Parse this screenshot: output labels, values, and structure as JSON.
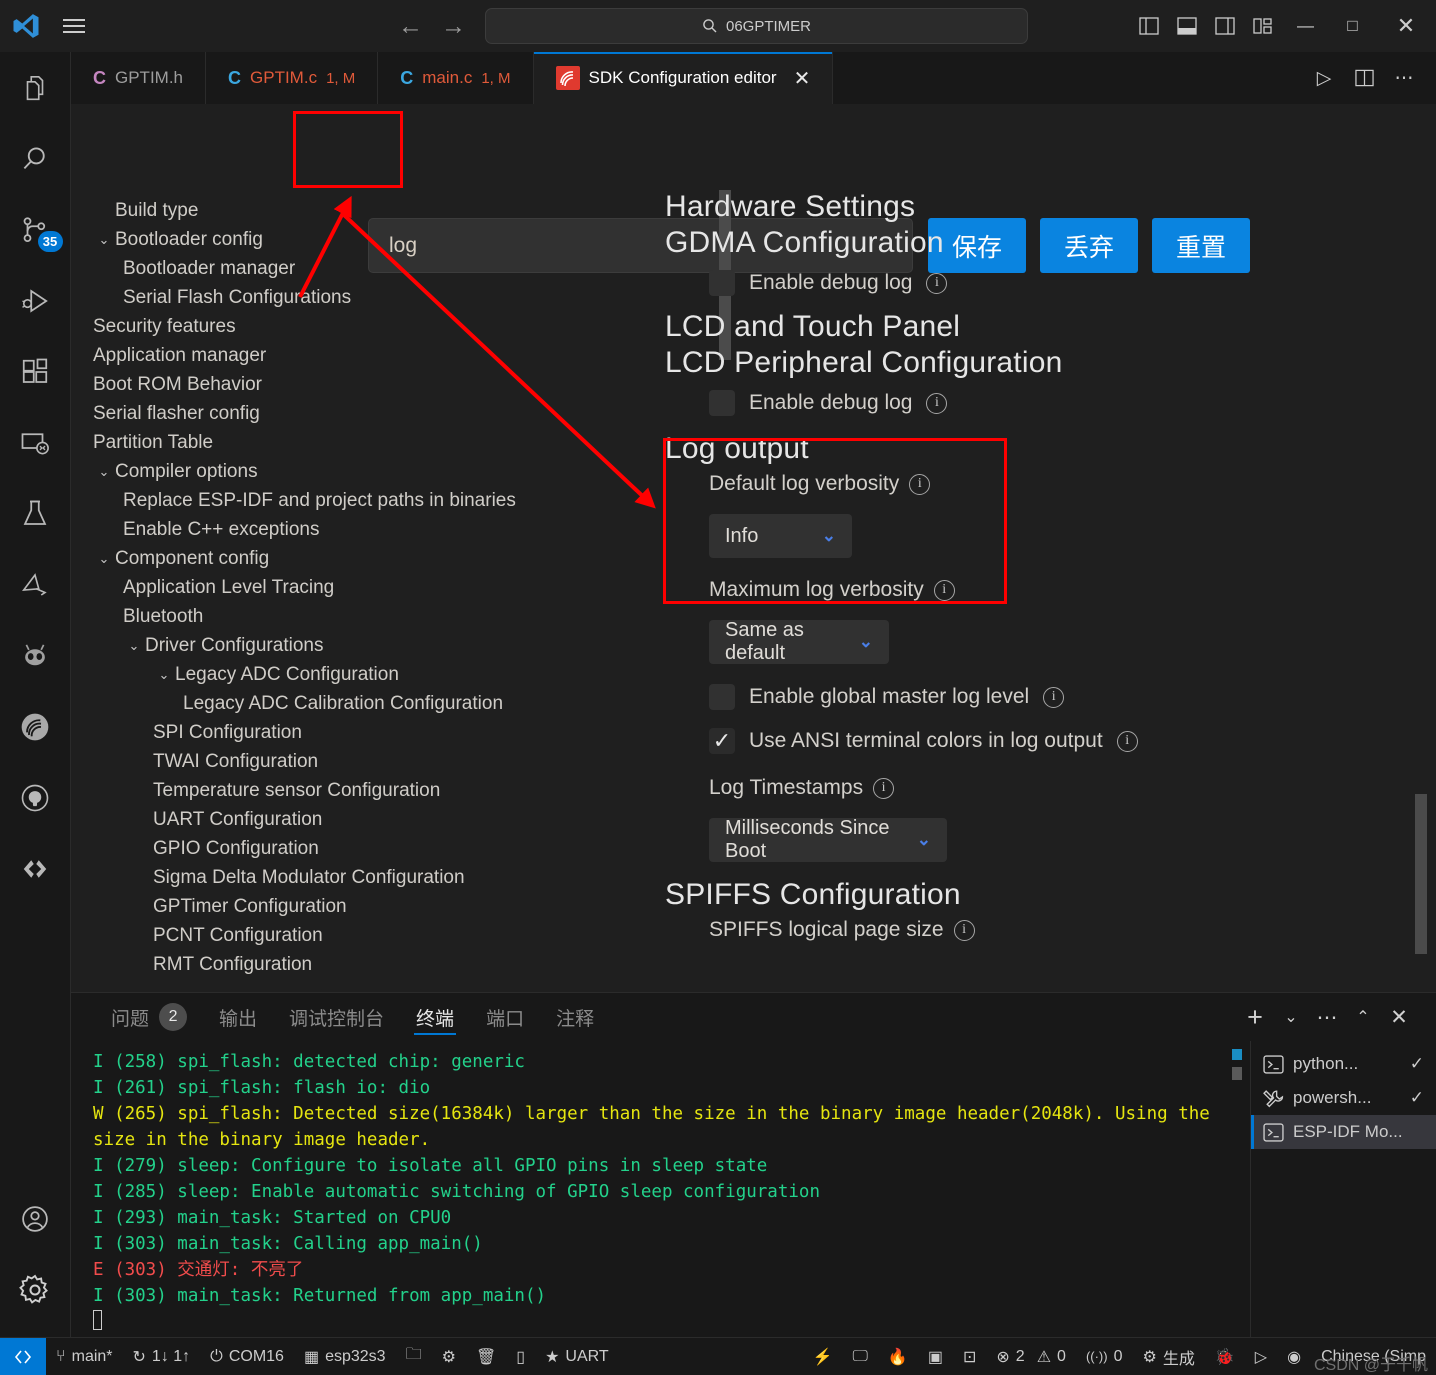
{
  "titlebar": {
    "quick_open_text": "06GPTIMER",
    "search_icon": "search-icon",
    "back_arrow": "←",
    "forward_arrow": "→",
    "minimize": "—",
    "maximize": "□",
    "close": "✕"
  },
  "editor_tabs": [
    {
      "lang": "C",
      "name": "GPTIM.h",
      "modifier": "",
      "active": false,
      "lang_color": "#c586c0",
      "name_color": "#9d9d9d"
    },
    {
      "lang": "C",
      "name": "GPTIM.c",
      "modifier": "1, M",
      "active": false,
      "lang_color": "#3ba7e0",
      "name_color": "#e05a3a"
    },
    {
      "lang": "C",
      "name": "main.c",
      "modifier": "1, M",
      "active": false,
      "lang_color": "#3ba7e0",
      "name_color": "#e05a3a"
    },
    {
      "lang": "",
      "name": "SDK Configuration editor",
      "modifier": "",
      "active": true,
      "lang_color": "#e03a2f",
      "name_color": "#ffffff"
    }
  ],
  "activity_bar": {
    "items": [
      {
        "icon": "explorer-files-icon",
        "badge": ""
      },
      {
        "icon": "search-icon",
        "badge": ""
      },
      {
        "icon": "source-control-icon",
        "badge": "35"
      },
      {
        "icon": "run-and-debug-icon",
        "badge": ""
      },
      {
        "icon": "extensions-icon",
        "badge": ""
      },
      {
        "icon": "remote-explorer-icon",
        "badge": ""
      },
      {
        "icon": "testing-flask-icon",
        "badge": ""
      },
      {
        "icon": "platformio-icon",
        "badge": ""
      },
      {
        "icon": "espressif-alien-icon",
        "badge": ""
      },
      {
        "icon": "esp-idf-icon",
        "badge": ""
      },
      {
        "icon": "github-icon",
        "badge": ""
      },
      {
        "icon": "code-brackets-icon",
        "badge": ""
      }
    ],
    "bottom_items": [
      {
        "icon": "account-icon"
      },
      {
        "icon": "settings-gear-icon"
      }
    ],
    "badge_color": "#0078d4"
  },
  "sdk": {
    "search_value": "log",
    "search_placeholder": "",
    "buttons": {
      "save": "保存",
      "discard": "丢弃",
      "reset": "重置"
    },
    "button_color": "#0a84e0",
    "tree": [
      {
        "label": "Build type",
        "indent": 0,
        "chevron": ""
      },
      {
        "label": "Bootloader config",
        "indent": 1,
        "chevron": "v"
      },
      {
        "label": "Bootloader manager",
        "indent": 2,
        "chevron": ""
      },
      {
        "label": "Serial Flash Configurations",
        "indent": 2,
        "chevron": ""
      },
      {
        "label": "Security features",
        "indent": 0,
        "chevron": ""
      },
      {
        "label": "Application manager",
        "indent": 0,
        "chevron": ""
      },
      {
        "label": "Boot ROM Behavior",
        "indent": 0,
        "chevron": ""
      },
      {
        "label": "Serial flasher config",
        "indent": 0,
        "chevron": ""
      },
      {
        "label": "Partition Table",
        "indent": 0,
        "chevron": ""
      },
      {
        "label": "Compiler options",
        "indent": 1,
        "chevron": "v"
      },
      {
        "label": "Replace ESP-IDF and project paths in binaries",
        "indent": 2,
        "chevron": ""
      },
      {
        "label": "Enable C++ exceptions",
        "indent": 2,
        "chevron": ""
      },
      {
        "label": "Component config",
        "indent": 1,
        "chevron": "v"
      },
      {
        "label": "Application Level Tracing",
        "indent": 2,
        "chevron": ""
      },
      {
        "label": "Bluetooth",
        "indent": 2,
        "chevron": ""
      },
      {
        "label": "Driver Configurations",
        "indent": 2,
        "chevron": "v"
      },
      {
        "label": "Legacy ADC Configuration",
        "indent": 3,
        "chevron": "v"
      },
      {
        "label": "Legacy ADC Calibration Configuration",
        "indent": 4,
        "chevron": ""
      },
      {
        "label": "SPI Configuration",
        "indent": 3,
        "chevron": ""
      },
      {
        "label": "TWAI Configuration",
        "indent": 3,
        "chevron": ""
      },
      {
        "label": "Temperature sensor Configuration",
        "indent": 3,
        "chevron": ""
      },
      {
        "label": "UART Configuration",
        "indent": 3,
        "chevron": ""
      },
      {
        "label": "GPIO Configuration",
        "indent": 3,
        "chevron": ""
      },
      {
        "label": "Sigma Delta Modulator Configuration",
        "indent": 3,
        "chevron": ""
      },
      {
        "label": "GPTimer Configuration",
        "indent": 3,
        "chevron": ""
      },
      {
        "label": "PCNT Configuration",
        "indent": 3,
        "chevron": ""
      },
      {
        "label": "RMT Configuration",
        "indent": 3,
        "chevron": ""
      }
    ],
    "pane": {
      "h_hardware_settings": "Hardware Settings",
      "h_gdma": "GDMA Configuration",
      "gdma_debug_label": "Enable debug log",
      "h_lcd_touch": "LCD and Touch Panel",
      "h_lcd_periph": "LCD Peripheral Configuration",
      "lcd_debug_label": "Enable debug log",
      "h_log_output": "Log output",
      "default_verbosity_label": "Default log verbosity",
      "default_verbosity_value": "Info",
      "max_verbosity_label": "Maximum log verbosity",
      "max_verbosity_value": "Same as default",
      "global_master_label": "Enable global master log level",
      "ansi_colors_label": "Use ANSI terminal colors in log output",
      "log_timestamps_label": "Log Timestamps",
      "log_timestamps_value": "Milliseconds Since Boot",
      "h_spiffs": "SPIFFS Configuration",
      "spiffs_page_label": "SPIFFS logical page size",
      "check_mark": "✓"
    }
  },
  "panel": {
    "tabs": [
      {
        "label": "问题",
        "badge": "2",
        "active": false
      },
      {
        "label": "输出",
        "badge": "",
        "active": false
      },
      {
        "label": "调试控制台",
        "badge": "",
        "active": false
      },
      {
        "label": "终端",
        "badge": "",
        "active": true
      },
      {
        "label": "端口",
        "badge": "",
        "active": false
      },
      {
        "label": "注释",
        "badge": "",
        "active": false
      }
    ],
    "actions": [
      {
        "icon": "add-terminal-icon",
        "glyph": "+"
      },
      {
        "icon": "chevron-down-icon",
        "glyph": "⌄"
      },
      {
        "icon": "more-actions-icon",
        "glyph": "⋯"
      },
      {
        "icon": "chevron-up-icon",
        "glyph": "⌃"
      },
      {
        "icon": "close-icon",
        "glyph": "✕"
      }
    ],
    "terminal_lines": [
      {
        "text": "I (258) spi_flash: detected chip: generic",
        "color": "green"
      },
      {
        "text": "I (261) spi_flash: flash io: dio",
        "color": "green"
      },
      {
        "text": "W (265) spi_flash: Detected size(16384k) larger than the size in the binary image header(2048k). Using the size in the binary image header.",
        "color": "yellow"
      },
      {
        "text": "I (279) sleep: Configure to isolate all GPIO pins in sleep state",
        "color": "green"
      },
      {
        "text": "I (285) sleep: Enable automatic switching of GPIO sleep configuration",
        "color": "green"
      },
      {
        "text": "I (293) main_task: Started on CPU0",
        "color": "green"
      },
      {
        "text": "I (303) main_task: Calling app_main()",
        "color": "green"
      },
      {
        "text": "E (303) 交通灯: 不亮了",
        "color": "red"
      },
      {
        "text": "I (303) main_task: Returned from app_main()",
        "color": "green"
      }
    ],
    "terminal_list": [
      {
        "icon": "terminal-icon",
        "name": "python...",
        "status": "✓",
        "selected": false
      },
      {
        "icon": "tools-icon",
        "name": "powersh...",
        "status": "✓",
        "selected": false
      },
      {
        "icon": "terminal-icon",
        "name": "ESP-IDF Mo...",
        "status": "",
        "selected": true
      }
    ]
  },
  "statusbar": {
    "remote_icon": "remote-window-icon",
    "left_items": [
      {
        "icon": "source-control-branch-icon",
        "glyph": "⑂",
        "label": "main*"
      },
      {
        "icon": "sync-icon",
        "glyph": "↻",
        "label": "1↓ 1↑"
      },
      {
        "icon": "plug-icon",
        "glyph": "⏻",
        "label": "COM16"
      },
      {
        "icon": "chip-icon",
        "glyph": "▦",
        "label": "esp32s3"
      },
      {
        "icon": "folder-icon",
        "glyph": "🗀",
        "label": ""
      },
      {
        "icon": "gear-icon",
        "glyph": "⚙",
        "label": ""
      },
      {
        "icon": "trash-icon",
        "glyph": "🗑",
        "label": ""
      },
      {
        "icon": "flash-device-icon",
        "glyph": "▯",
        "label": ""
      },
      {
        "icon": "star-uart-icon",
        "glyph": "★",
        "label": "UART"
      }
    ],
    "right_items": [
      {
        "icon": "lightning-icon",
        "glyph": "⚡",
        "label": ""
      },
      {
        "icon": "monitor-icon",
        "glyph": "🖵",
        "label": ""
      },
      {
        "icon": "flame-icon",
        "glyph": "🔥",
        "label": ""
      },
      {
        "icon": "terminal-icon",
        "glyph": "▣",
        "label": ""
      },
      {
        "icon": "export-icon",
        "glyph": "⊡",
        "label": ""
      },
      {
        "icon": "error-icon",
        "glyph": "⊗",
        "label": "2"
      },
      {
        "icon": "warning-icon",
        "glyph": "⚠",
        "label": "0"
      },
      {
        "icon": "radio-tower-icon",
        "glyph": "((·))",
        "label": "0"
      },
      {
        "icon": "build-gear-icon",
        "glyph": "⚙",
        "label": "生成"
      },
      {
        "icon": "debug-bug-icon",
        "glyph": "🐞",
        "label": ""
      },
      {
        "icon": "run-icon",
        "glyph": "▷",
        "label": ""
      },
      {
        "icon": "eye-icon",
        "glyph": "◉",
        "label": ""
      },
      {
        "icon": "language-icon",
        "glyph": "",
        "label": "Chinese (Simp"
      }
    ],
    "watermark": "CSDN @于千帆"
  },
  "annotations": {
    "color": "#ff0000"
  }
}
